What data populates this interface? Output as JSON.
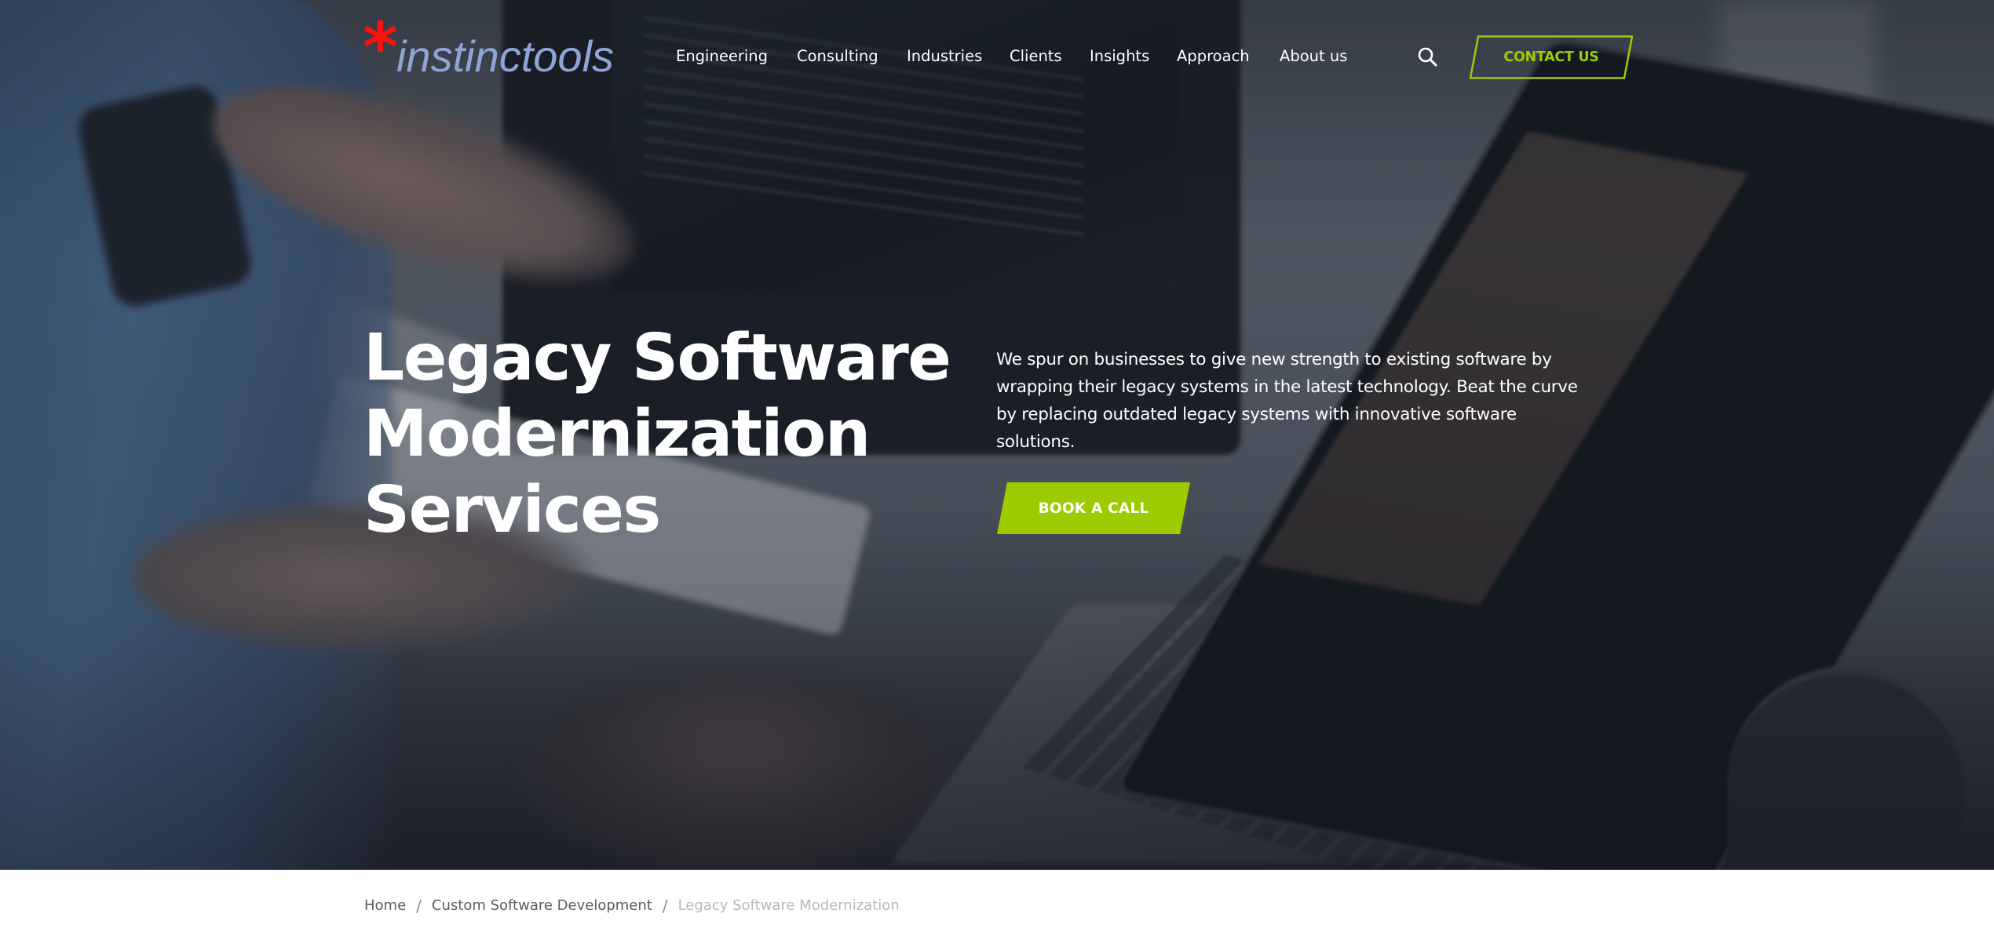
{
  "brand": {
    "logo_mark": "*",
    "logo_text": "instinctools",
    "logo_mark_color": "#ff1010",
    "logo_text_color": "#8fa6d4"
  },
  "nav": {
    "items": [
      {
        "label": "Engineering"
      },
      {
        "label": "Consulting"
      },
      {
        "label": "Industries"
      },
      {
        "label": "Clients"
      },
      {
        "label": "Insights"
      },
      {
        "label": "Approach"
      },
      {
        "label": "About us"
      }
    ],
    "search_icon": "search-icon",
    "contact_label": "CONTACT US"
  },
  "hero": {
    "title_lines": [
      "Legacy Software",
      "Modernization",
      "Services"
    ],
    "description": "We spur on businesses to give new strength to existing software by wrapping their legacy systems in the latest technology. Beat the curve by replacing outdated legacy systems with innovative software solutions.",
    "cta_label": "BOOK A CALL"
  },
  "breadcrumb": {
    "items": [
      {
        "label": "Home"
      },
      {
        "label": "Custom Software Development"
      }
    ],
    "separator": "/",
    "current": "Legacy Software Modernization"
  },
  "colors": {
    "accent": "#9ccc00",
    "text_on_dark": "#ffffff",
    "breadcrumb_link": "#5b5b5b",
    "breadcrumb_current": "#b8b8b8"
  }
}
